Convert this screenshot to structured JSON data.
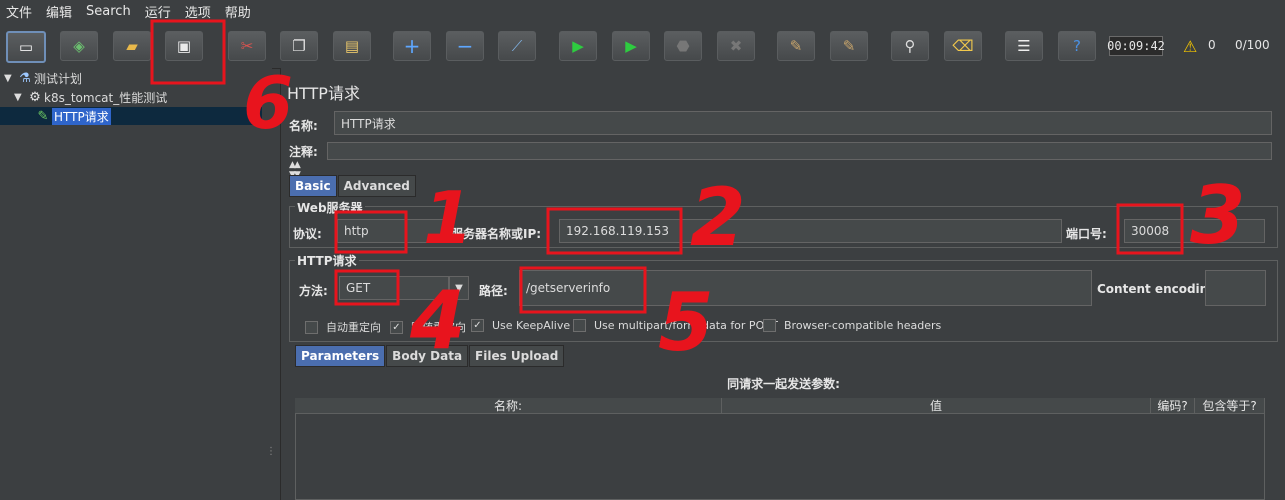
{
  "menu": [
    "文件",
    "编辑",
    "Search",
    "运行",
    "选项",
    "帮助"
  ],
  "toolbar": {
    "icons": [
      "new-icon",
      "templates-icon",
      "open-icon",
      "save-icon",
      "cut-icon",
      "copy-icon",
      "paste-icon",
      "expand-icon",
      "collapse-icon",
      "toggle-icon",
      "start-icon",
      "start-no-pause-icon",
      "stop-icon",
      "shutdown-icon",
      "clear-icon",
      "clear-all-icon",
      "search-icon",
      "reset-search-icon",
      "function-helper-icon",
      "help-icon"
    ],
    "elapsed": "00:09:42",
    "warnings": "0",
    "threads": "0/100"
  },
  "tree": {
    "plan": "测试计划",
    "group": "k8s_tomcat_性能测试",
    "sampler": "HTTP请求"
  },
  "panel": {
    "title": "HTTP请求",
    "name_label": "名称:",
    "name_value": "HTTP请求",
    "comment_label": "注释:",
    "tab_basic": "Basic",
    "tab_advanced": "Advanced",
    "web_server_title": "Web服务器",
    "protocol_label": "协议:",
    "protocol_value": "http",
    "server_label": "服务器名称或IP:",
    "server_value": "192.168.119.153",
    "port_label": "端口号:",
    "port_value": "30008",
    "http_request_title": "HTTP请求",
    "method_label": "方法:",
    "method_value": "GET",
    "path_label": "路径:",
    "path_value": "/getserverinfo",
    "encoding_label": "Content encoding:",
    "options": [
      {
        "label": "自动重定向",
        "checked": false
      },
      {
        "label": "跟随重定向",
        "checked": true
      },
      {
        "label": "Use KeepAlive",
        "checked": true
      },
      {
        "label": "Use multipart/form-data for POST",
        "checked": false
      },
      {
        "label": "Browser-compatible headers",
        "checked": false
      }
    ],
    "subtabs": [
      "Parameters",
      "Body Data",
      "Files Upload"
    ],
    "params_caption": "同请求一起发送参数:",
    "columns": [
      "名称:",
      "值",
      "编码?",
      "包含等于?"
    ]
  },
  "annotations": [
    "1",
    "2",
    "3",
    "4",
    "5",
    "6"
  ]
}
